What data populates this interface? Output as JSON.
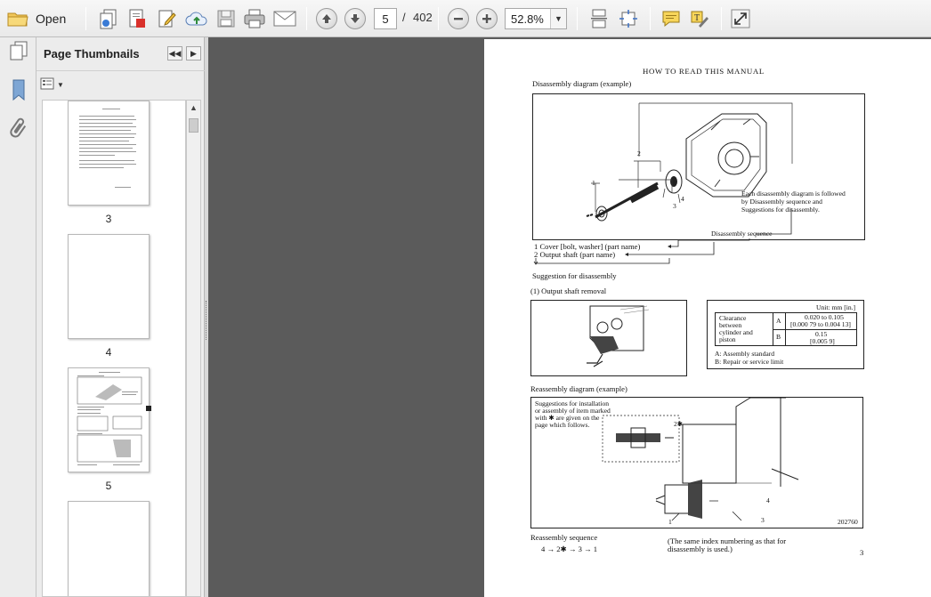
{
  "toolbar": {
    "open_label": "Open",
    "page_current": "5",
    "page_sep": "/",
    "page_total": "402",
    "zoom_value": "52.8%"
  },
  "thumbnails": {
    "title": "Page Thumbnails",
    "pages": [
      {
        "label": "3",
        "selected": false
      },
      {
        "label": "4",
        "selected": false
      },
      {
        "label": "5",
        "selected": true
      },
      {
        "label": "",
        "selected": false
      }
    ]
  },
  "page": {
    "header": "HOW TO READ THIS MANUAL",
    "disassembly_title": "Disassembly diagram (example)",
    "callout_1": "1",
    "callout_2": "2",
    "callout_3": "3",
    "callout_4": "4",
    "note_disassembly": [
      "Each disassembly diagram is followed",
      "by Disassembly sequence and",
      "Suggestions for disassembly."
    ],
    "seq_label": "Disassembly sequence",
    "seq_item_1": "1  Cover [bolt, washer] (part name)",
    "seq_item_2": "2  Output shaft (part name)",
    "suggestion_title": "Suggestion for disassembly",
    "step_1": "(1)  Output shaft removal",
    "table": {
      "unit": "Unit: mm [in.]",
      "row_label": [
        "Clearance",
        "between",
        "cylinder and",
        "piston"
      ],
      "row_a_key": "A",
      "row_a_value": [
        "0.020 to 0.105",
        "[0.000 79 to 0.004 13]"
      ],
      "row_b_key": "B",
      "row_b_value": [
        "0.15",
        "[0.005 9]"
      ],
      "legend_a": "A:  Assembly standard",
      "legend_b": "B:  Repair or service limit"
    },
    "reassembly_title": "Reassembly diagram (example)",
    "note_reassembly": [
      "Suggestions for installation",
      "or assembly of item marked",
      "with ✱ are given on the",
      "page which follows."
    ],
    "reassembly_callout_2": "2✱",
    "reassembly_callout_4": "4",
    "reassembly_callout_1": "1",
    "reassembly_callout_3": "3",
    "figure_number": "202760",
    "reassembly_seq_title": "Reassembly sequence",
    "reassembly_seq": "4  →  2✱ → 3  →  1",
    "footnote": [
      "(The  same  index  numbering  as  that  for",
      "disassembly  is  used.)"
    ],
    "page_number": "3"
  }
}
